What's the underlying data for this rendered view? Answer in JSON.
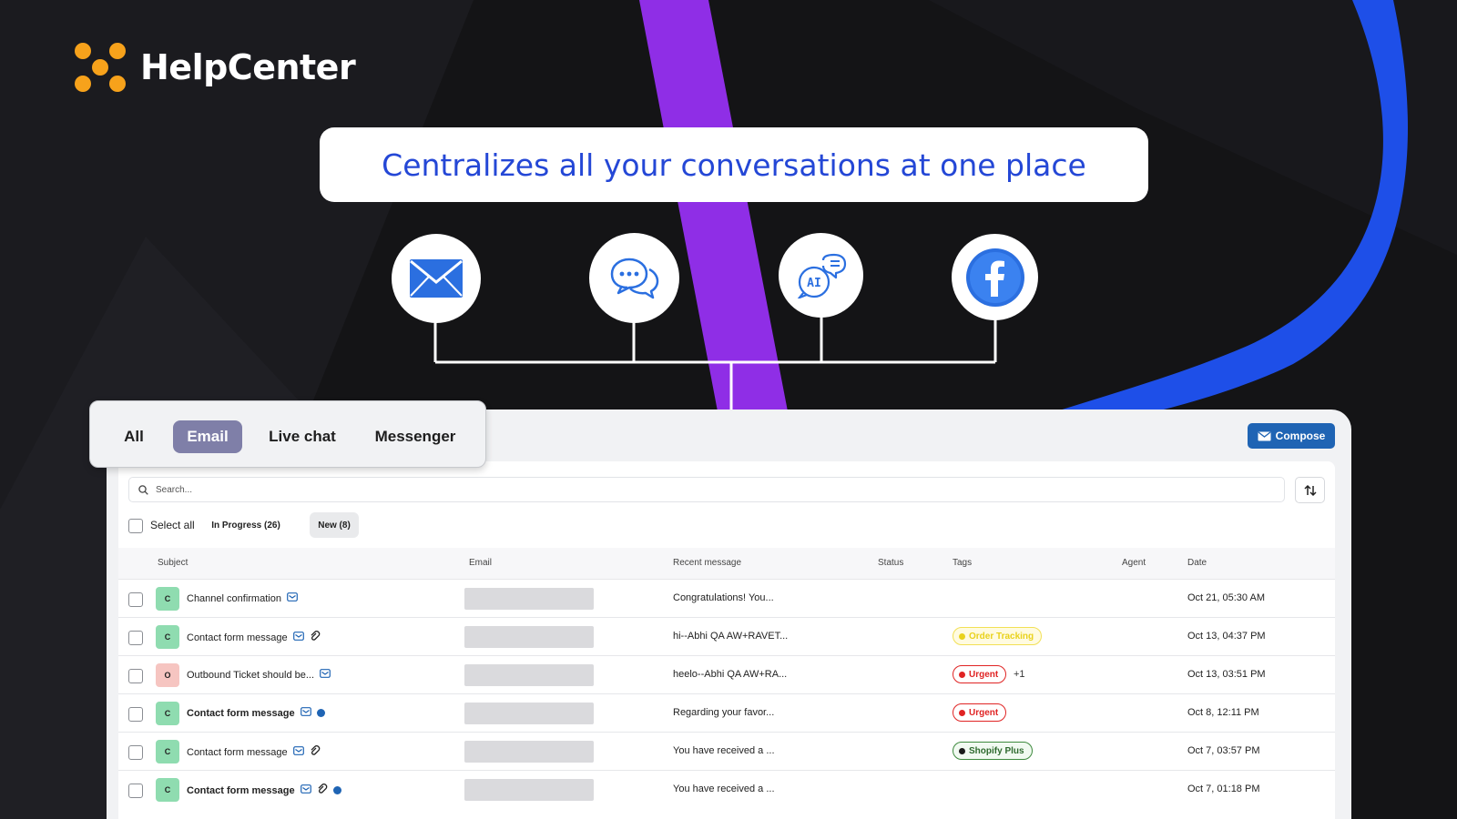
{
  "brand": {
    "name": "HelpCenter",
    "accent_color": "#f7a21b"
  },
  "banner": {
    "text": "Centralizes all your conversations at one place",
    "text_color": "#2447d6"
  },
  "channels": [
    {
      "name": "email",
      "icon": "envelope-icon"
    },
    {
      "name": "live chat",
      "icon": "chat-bubbles-icon"
    },
    {
      "name": "ai chat",
      "icon": "ai-chat-icon",
      "label": "AI"
    },
    {
      "name": "messenger",
      "icon": "facebook-icon"
    }
  ],
  "tabs": [
    {
      "label": "All",
      "active": false
    },
    {
      "label": "Email",
      "active": true
    },
    {
      "label": "Live chat",
      "active": false
    },
    {
      "label": "Messenger",
      "active": false
    }
  ],
  "toolbar": {
    "compose_label": "Compose",
    "search_placeholder": "Search..."
  },
  "filters": {
    "select_all_label": "Select all",
    "in_progress_label": "In Progress (26)",
    "new_label": "New (8)"
  },
  "table": {
    "columns": {
      "subject": "Subject",
      "email": "Email",
      "recent_message": "Recent message",
      "status": "Status",
      "tags": "Tags",
      "agent": "Agent",
      "date": "Date"
    },
    "rows": [
      {
        "avatar": "C",
        "avatar_color": "#8fdcb0",
        "subject": "Channel confirmation",
        "bold": false,
        "attachment": false,
        "unread": false,
        "recent": "Congratulations! You...",
        "tag": "",
        "tag_extra": "",
        "date": "Oct 21, 05:30 AM"
      },
      {
        "avatar": "C",
        "avatar_color": "#8fdcb0",
        "subject": "Contact form message",
        "bold": false,
        "attachment": true,
        "unread": false,
        "recent": "hi--Abhi QA AW+RAVET...",
        "tag": "Order Tracking",
        "tag_extra": "",
        "date": "Oct 13, 04:37 PM"
      },
      {
        "avatar": "O",
        "avatar_color": "#f6c5c1",
        "subject": "Outbound Ticket should be...",
        "bold": false,
        "attachment": false,
        "unread": false,
        "recent": "heelo--Abhi QA AW+RA...",
        "tag": "Urgent",
        "tag_extra": "+1",
        "date": "Oct 13, 03:51 PM"
      },
      {
        "avatar": "C",
        "avatar_color": "#8fdcb0",
        "subject": "Contact form message",
        "bold": true,
        "attachment": false,
        "unread": true,
        "recent": "Regarding your favor...",
        "tag": "Urgent",
        "tag_extra": "",
        "date": "Oct 8, 12:11 PM"
      },
      {
        "avatar": "C",
        "avatar_color": "#8fdcb0",
        "subject": "Contact form message",
        "bold": false,
        "attachment": true,
        "unread": false,
        "recent": "You have received a ...",
        "tag": "Shopify Plus",
        "tag_extra": "",
        "date": "Oct 7, 03:57 PM"
      },
      {
        "avatar": "C",
        "avatar_color": "#8fdcb0",
        "subject": "Contact form message",
        "bold": true,
        "attachment": true,
        "unread": true,
        "recent": "You have received a ...",
        "tag": "",
        "tag_extra": "",
        "date": "Oct 7, 01:18 PM"
      }
    ]
  },
  "tag_styles": {
    "Order Tracking": {
      "color": "#e9d21c",
      "bg": "#fffbe0",
      "border": "#f2e055"
    },
    "Urgent": {
      "color": "#e02424",
      "bg": "#ffffff",
      "border": "#e02424"
    },
    "Shopify Plus": {
      "color": "#2e6a2e",
      "bg": "#f1faf1",
      "border": "#3d8a3d"
    }
  },
  "colors": {
    "primary_blue": "#1f64b4",
    "stripe_purple": "#8f2ee6",
    "stripe_blue": "#1e4fe8",
    "active_tab": "#7f7fa8"
  }
}
